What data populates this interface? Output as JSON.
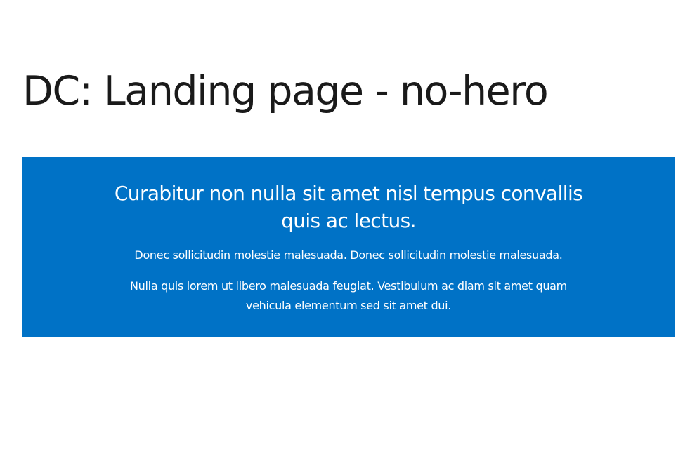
{
  "page": {
    "title": "DC: Landing page - no-hero"
  },
  "banner": {
    "background_color": "#0072c6",
    "text_color": "#ffffff",
    "heading": "Curabitur non nulla sit amet nisl tempus convallis quis ac lectus.",
    "paragraphs": [
      "Donec sollicitudin molestie malesuada. Donec sollicitudin molestie malesuada.",
      "Nulla quis lorem ut libero malesuada feugiat. Vestibulum ac diam sit amet quam vehicula elementum sed sit amet dui."
    ]
  }
}
